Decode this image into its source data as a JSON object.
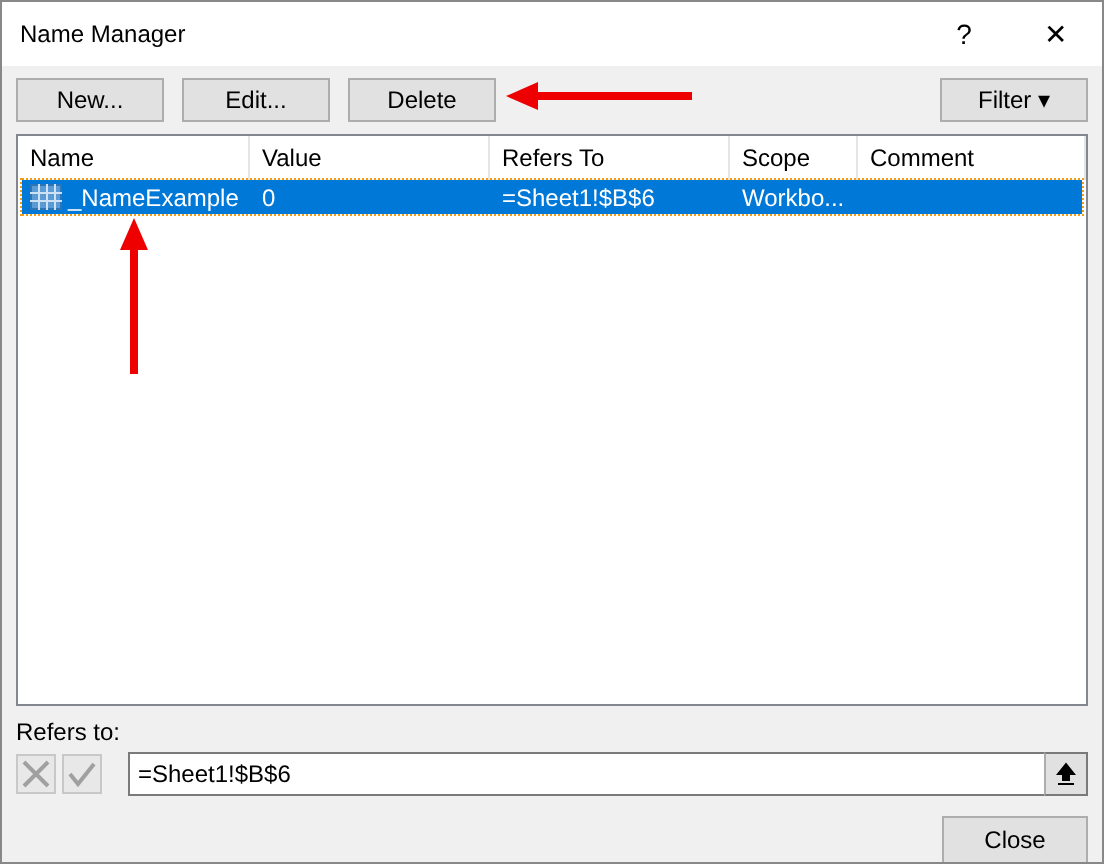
{
  "window": {
    "title": "Name Manager",
    "help": "?",
    "close": "✕"
  },
  "buttons": [
    {
      "label": "New..."
    },
    {
      "label": "Edit..."
    },
    {
      "label": "Delete"
    }
  ],
  "filter": {
    "label": "Filter",
    "caret": "▾"
  },
  "table": {
    "columns": [
      "Name",
      "Value",
      "Refers To",
      "Scope",
      "Comment"
    ],
    "rows": [
      {
        "selected": true,
        "cells": [
          "_NameExample",
          "0",
          "=Sheet1!$B$6",
          "Workbo...",
          ""
        ]
      }
    ]
  },
  "refers_to": {
    "label": "Refers to:",
    "value": "=Sheet1!$B$6"
  },
  "close_button": "Close"
}
